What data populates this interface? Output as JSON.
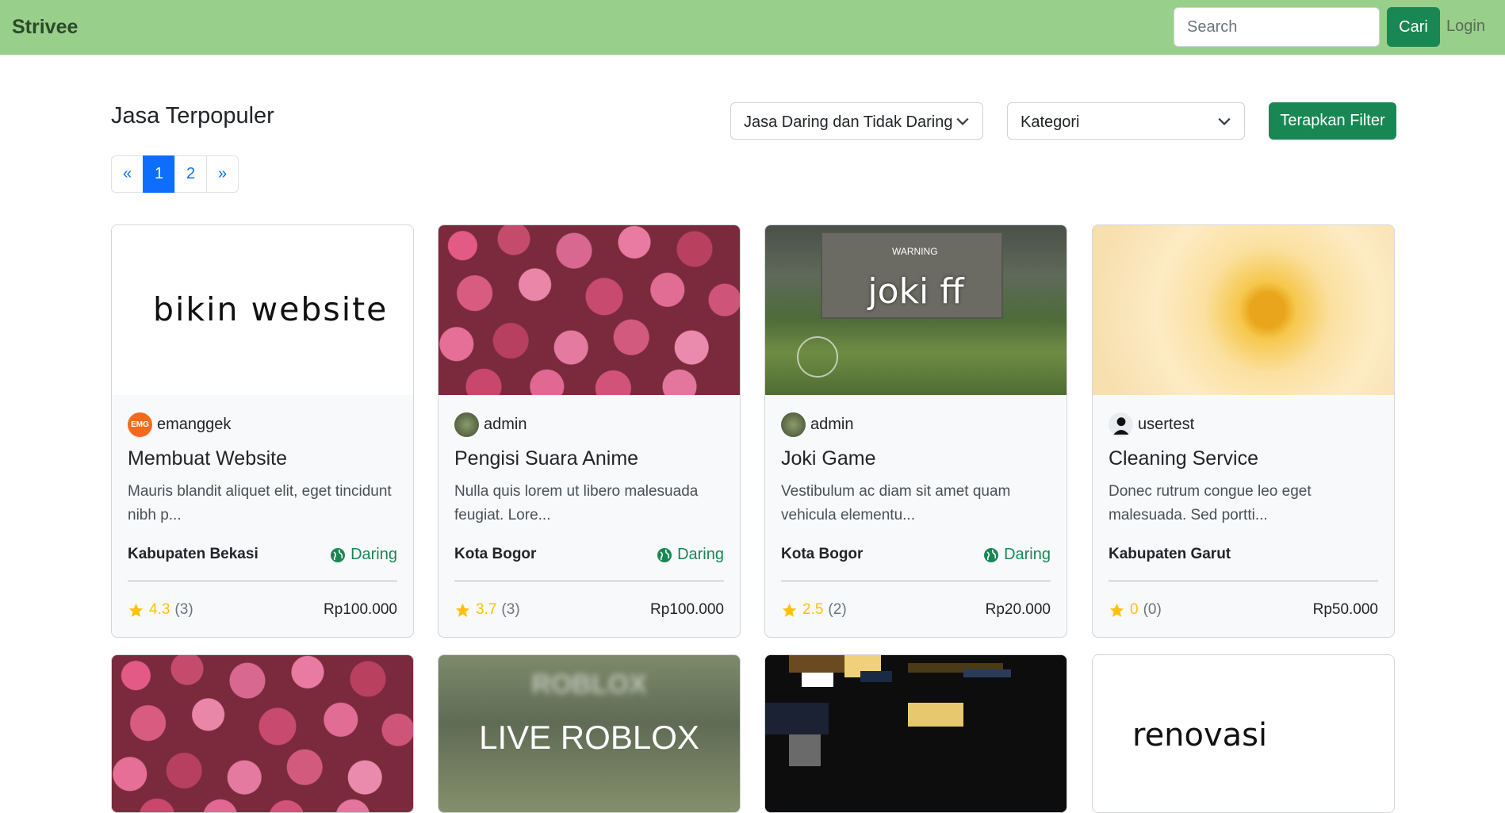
{
  "navbar": {
    "brand": "Strivee",
    "search_placeholder": "Search",
    "search_button": "Cari",
    "login": "Login",
    "bg_color": "#98cf8a"
  },
  "header": {
    "title": "Jasa Terpopuler",
    "filter_mode_selected": "Jasa Daring dan Tidak Daring",
    "filter_category_selected": "Kategori",
    "apply_button": "Terapkan Filter"
  },
  "pagination": {
    "prev": "«",
    "pages": [
      "1",
      "2"
    ],
    "active_page": "1",
    "next": "»"
  },
  "cards": [
    {
      "image_text": "bikin website",
      "author": "emanggek",
      "title": "Membuat Website",
      "description": "Mauris blandit aliquet elit, eget tincidunt nibh p...",
      "location": "Kabupaten Bekasi",
      "mode": "Daring",
      "rating": "4.3",
      "review_count": "(3)",
      "price": "Rp100.000"
    },
    {
      "image_text": "",
      "author": "admin",
      "title": "Pengisi Suara Anime",
      "description": "Nulla quis lorem ut libero malesuada feugiat. Lore...",
      "location": "Kota Bogor",
      "mode": "Daring",
      "rating": "3.7",
      "review_count": "(3)",
      "price": "Rp100.000"
    },
    {
      "image_text": "joki ff",
      "author": "admin",
      "title": "Joki Game",
      "description": "Vestibulum ac diam sit amet quam vehicula elementu...",
      "location": "Kota Bogor",
      "mode": "Daring",
      "rating": "2.5",
      "review_count": "(2)",
      "price": "Rp20.000"
    },
    {
      "image_text": "",
      "author": "usertest",
      "title": "Cleaning Service",
      "description": "Donec rutrum congue leo eget malesuada. Sed portti...",
      "location": "Kabupaten Garut",
      "mode": "",
      "rating": "0",
      "review_count": "(0)",
      "price": "Rp50.000"
    }
  ],
  "cards_row2": [
    {
      "image_text": ""
    },
    {
      "image_text": "LIVE ROBLOX",
      "image_subtext": "ROBLOX"
    },
    {
      "image_text": ""
    },
    {
      "image_text": "renovasi"
    }
  ],
  "colors": {
    "success": "#198754",
    "primary": "#0d6efd",
    "star": "#ffc107"
  }
}
